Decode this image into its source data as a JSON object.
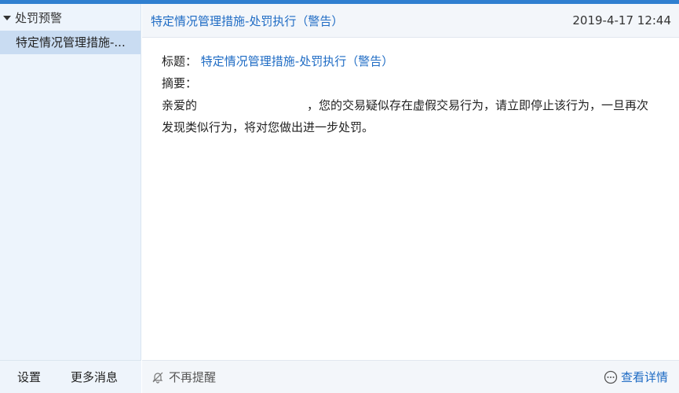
{
  "sidebar": {
    "header": "处罚预警",
    "items": [
      {
        "label": "特定情况管理措施-..."
      }
    ],
    "footer": {
      "settings": "设置",
      "more": "更多消息"
    }
  },
  "message": {
    "title": "特定情况管理措施-处罚执行（警告）",
    "time": "2019-4-17 12:44",
    "title_label": "标题：",
    "summary_label": "摘要：",
    "greeting": "亲爱的",
    "body": "，您的交易疑似存在虚假交易行为，请立即停止该行为，一旦再次发现类似行为，将对您做出进一步处罚。"
  },
  "footer": {
    "no_remind": "不再提醒",
    "view_detail": "查看详情"
  },
  "colors": {
    "accent": "#1e6bc4",
    "sidebar_bg": "#edf4fc",
    "selected": "#c9dcf2"
  }
}
